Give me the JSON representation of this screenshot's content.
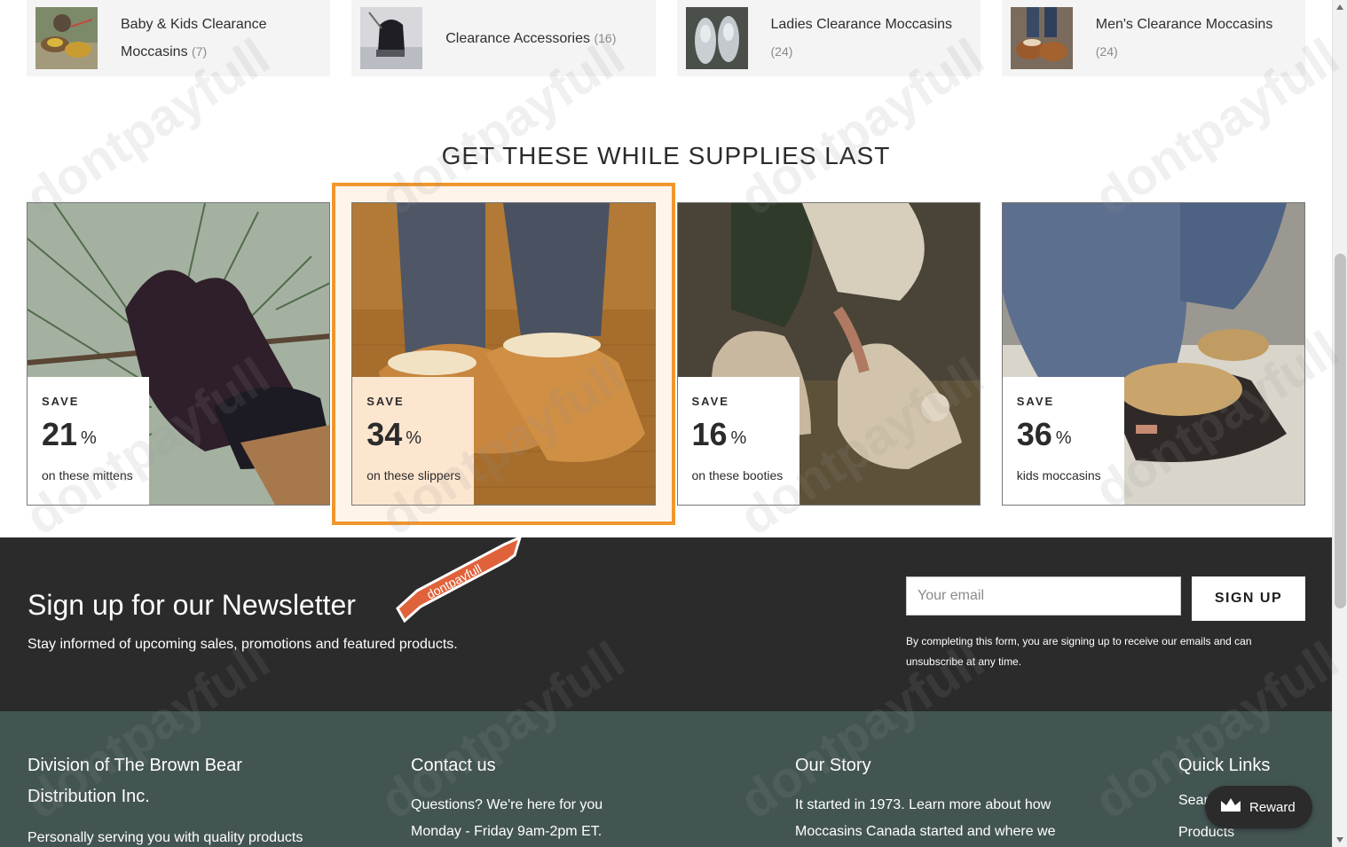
{
  "categories": [
    {
      "name": "Baby & Kids Clearance Moccasins",
      "count": "(7)",
      "icon": "baby-moccasins-thumbnail"
    },
    {
      "name": "Clearance Accessories",
      "count": "(16)",
      "icon": "accessories-thumbnail"
    },
    {
      "name": "Ladies Clearance Moccasins",
      "count": "(24)",
      "icon": "ladies-moccasins-thumbnail"
    },
    {
      "name": "Men's Clearance Moccasins",
      "count": "(24)",
      "icon": "mens-moccasins-thumbnail"
    }
  ],
  "section_title": "GET THESE WHILE SUPPLIES LAST",
  "promos": [
    {
      "save": "SAVE",
      "percent": "21",
      "sign": "%",
      "note": "on these mittens",
      "image": "mitten-on-pine-branch"
    },
    {
      "save": "SAVE",
      "percent": "34",
      "sign": "%",
      "note": "on these slippers",
      "image": "moccasin-slippers-on-rug"
    },
    {
      "save": "SAVE",
      "percent": "16",
      "sign": "%",
      "note": "on these booties",
      "image": "sherpa-booties"
    },
    {
      "save": "SAVE",
      "percent": "36",
      "sign": "%",
      "note": "kids moccasins",
      "image": "fur-trim-moccasins"
    }
  ],
  "newsletter": {
    "title": "Sign up for our Newsletter",
    "subtitle": "Stay informed of upcoming sales, promotions and featured products.",
    "email_placeholder": "Your email",
    "button_label": "SIGN UP",
    "note": "By completing this form, you are signing up to receive our emails and can unsubscribe at any time."
  },
  "badge_text": "dontpayfull",
  "footer": {
    "col1": {
      "title": "Division of The Brown Bear Distribution Inc.",
      "text": "Personally serving you with quality products"
    },
    "col2": {
      "title": "Contact us",
      "line1": "Questions? We're here for you",
      "line2": "Monday - Friday 9am-2pm ET."
    },
    "col3": {
      "title": "Our Story",
      "line1": "It started in 1973. Learn more about how",
      "line2": "Moccasins Canada started and where we"
    },
    "col4": {
      "title": "Quick Links",
      "links": [
        "Search",
        "Products"
      ]
    }
  },
  "reward": {
    "label": "Reward",
    "icon": "crown-icon"
  },
  "watermark": "dontpayfull",
  "colors": {
    "accent": "#f0962e",
    "highlight_box": "#fde6cf",
    "newsletter_bg": "#2b2b2b",
    "footer_bg": "#435553",
    "badge": "#e0623a"
  }
}
